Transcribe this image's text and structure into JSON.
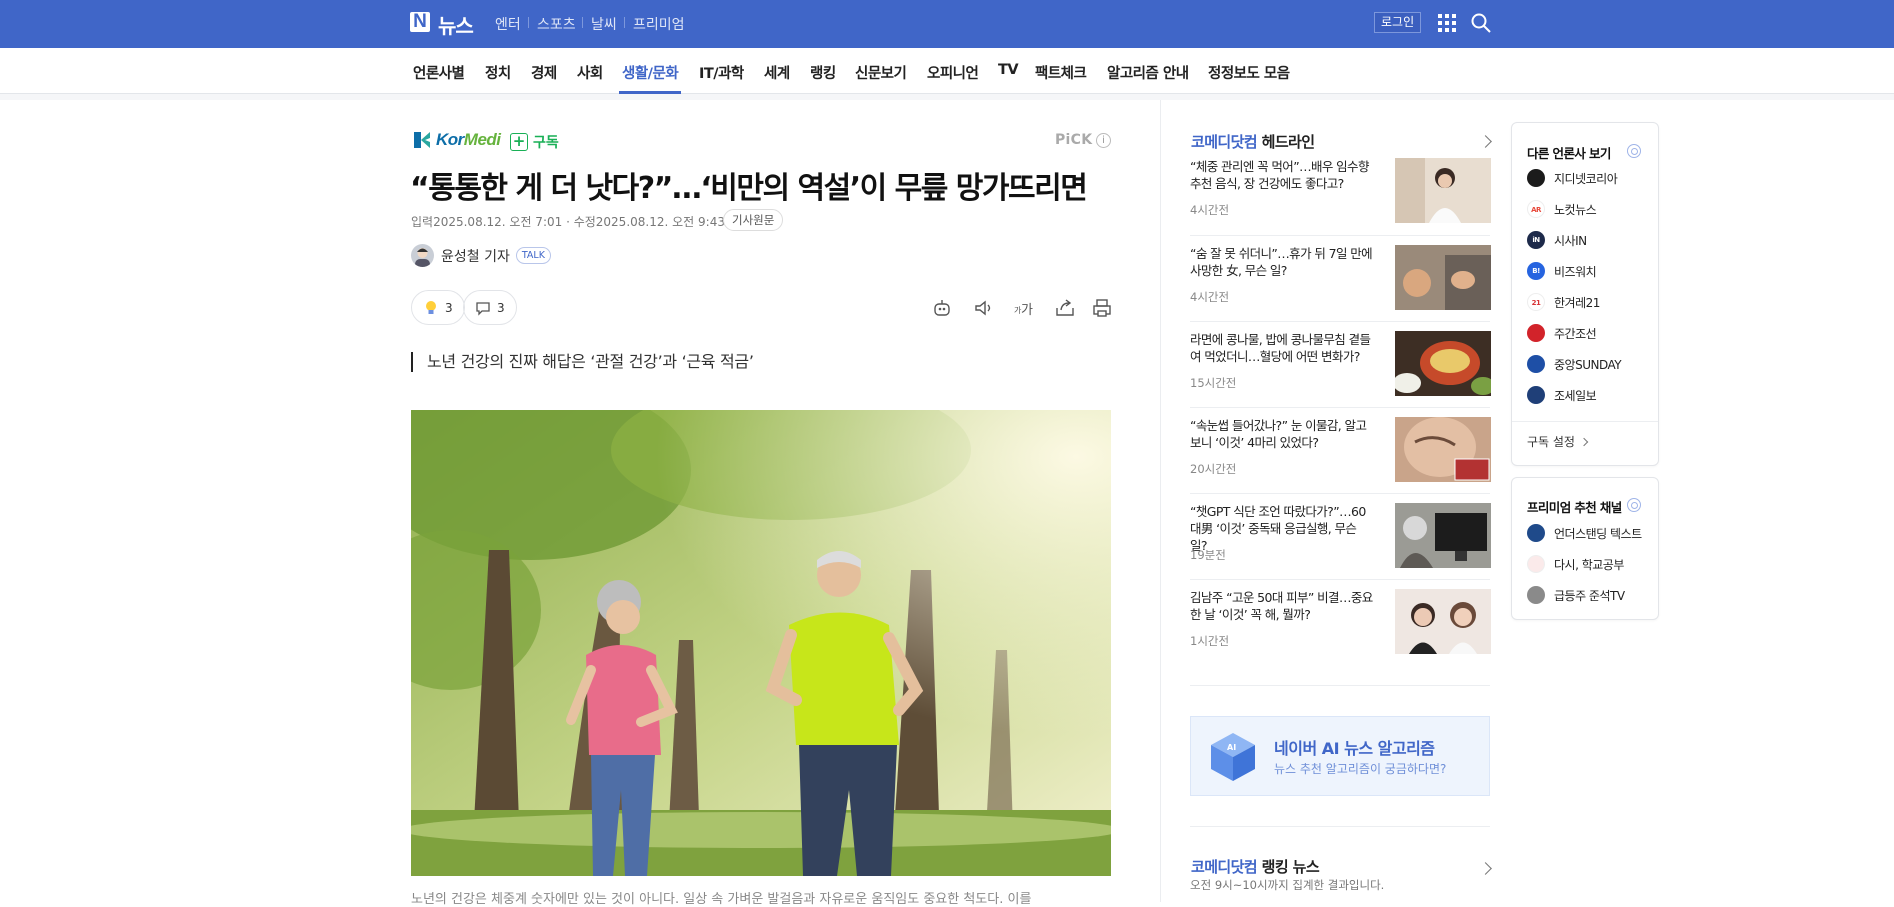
{
  "header": {
    "brand": "뉴스",
    "services": [
      "엔터",
      "스포츠",
      "날씨",
      "프리미엄"
    ],
    "login_label": "로그인"
  },
  "nav": {
    "items": [
      "언론사별",
      "정치",
      "경제",
      "사회",
      "생활/문화",
      "IT/과학",
      "세계",
      "랭킹",
      "신문보기",
      "오피니언",
      "TV",
      "팩트체크",
      "알고리즘 안내",
      "정정보도 모음"
    ],
    "active": "생활/문화"
  },
  "article": {
    "press_name_1": "Kor",
    "press_name_2": "Medi",
    "subscribe_label": "구독",
    "pick_label": "PiCK",
    "pick_info": "i",
    "headline": "“통통한 게 더 낫다?”…‘비만의 역설’이 무릎 망가뜨리면",
    "dates": "입력2025.08.12. 오전 7:01 · 수정2025.08.12. 오전 9:43",
    "original_label": "기사원문",
    "reporter": "윤성철 기자",
    "talk_label": "TALK",
    "reaction_count": "3",
    "comment_count": "3",
    "summary": "노년 건강의 진짜 해답은 ‘관절 건강’과 ‘근육 적금’",
    "caption": "노년의 건강은 체중계 숫자에만 있는 것이 아니다. 일상 속 가벼운 발걸음과 자유로운 움직임도 중요한 척도다. 이를"
  },
  "sidebar": {
    "headline_section_brand": "코메디닷컴",
    "headline_section_title": "헤드라인",
    "headlines": [
      {
        "title": "“체중 관리엔 꼭 먹어”…배우 임수향 추천 음식, 장 건강에도 좋다고?",
        "time": "4시간전"
      },
      {
        "title": "“숨 잘 못 쉬더니”…휴가 뒤 7일 만에 사망한 女, 무슨 일?",
        "time": "4시간전"
      },
      {
        "title": "라면에 콩나물, 밥에 콩나물무침 곁들여 먹었더니…혈당에 어떤 변화가?",
        "time": "15시간전"
      },
      {
        "title": "“속눈썹 들어갔나?” 눈 이물감, 알고보니 ‘이것’ 4마리 있었다?",
        "time": "20시간전"
      },
      {
        "title": "“챗GPT 식단 조언 따랐다가?”…60대男 ‘이것’ 중독돼 응급실행, 무슨 일?",
        "time": "19분전"
      },
      {
        "title": "김남주 “고운 50대 피부” 비결…중요한 날 ‘이것’ 꼭 해, 뭘까?",
        "time": "1시간전"
      }
    ],
    "ai_title": "네이버 AI 뉴스 알고리즘",
    "ai_subtitle": "뉴스 추천 알고리즘이 궁금하다면?",
    "ranking_brand": "코메디닷컴",
    "ranking_title": "랭킹 뉴스",
    "ranking_subtitle": "오전 9시~10시까지 집계한 결과입니다."
  },
  "right_cards": {
    "other_press_title": "다른 언론사 보기",
    "other_press": [
      {
        "name": "지디넷코리아",
        "color": "#1b1b1b"
      },
      {
        "name": "노컷뉴스",
        "color": "#e84a3c"
      },
      {
        "name": "시사IN",
        "color": "#1d2a4a"
      },
      {
        "name": "비즈워치",
        "color": "#2664e0"
      },
      {
        "name": "한겨레21",
        "color": "#d73235"
      },
      {
        "name": "주간조선",
        "color": "#d2232a"
      },
      {
        "name": "중앙SUNDAY",
        "color": "#1e4fa6"
      },
      {
        "name": "조세일보",
        "color": "#1f3f78"
      }
    ],
    "subscribe_settings": "구독 설정",
    "premium_title": "프리미엄 추천 채널",
    "premium": [
      {
        "name": "언더스탠딩 텍스트",
        "color": "#1f4a8a"
      },
      {
        "name": "다시, 학교공부",
        "color": "#e8c7c7"
      },
      {
        "name": "급등주 준석TV",
        "color": "#8a8a8a"
      }
    ]
  }
}
